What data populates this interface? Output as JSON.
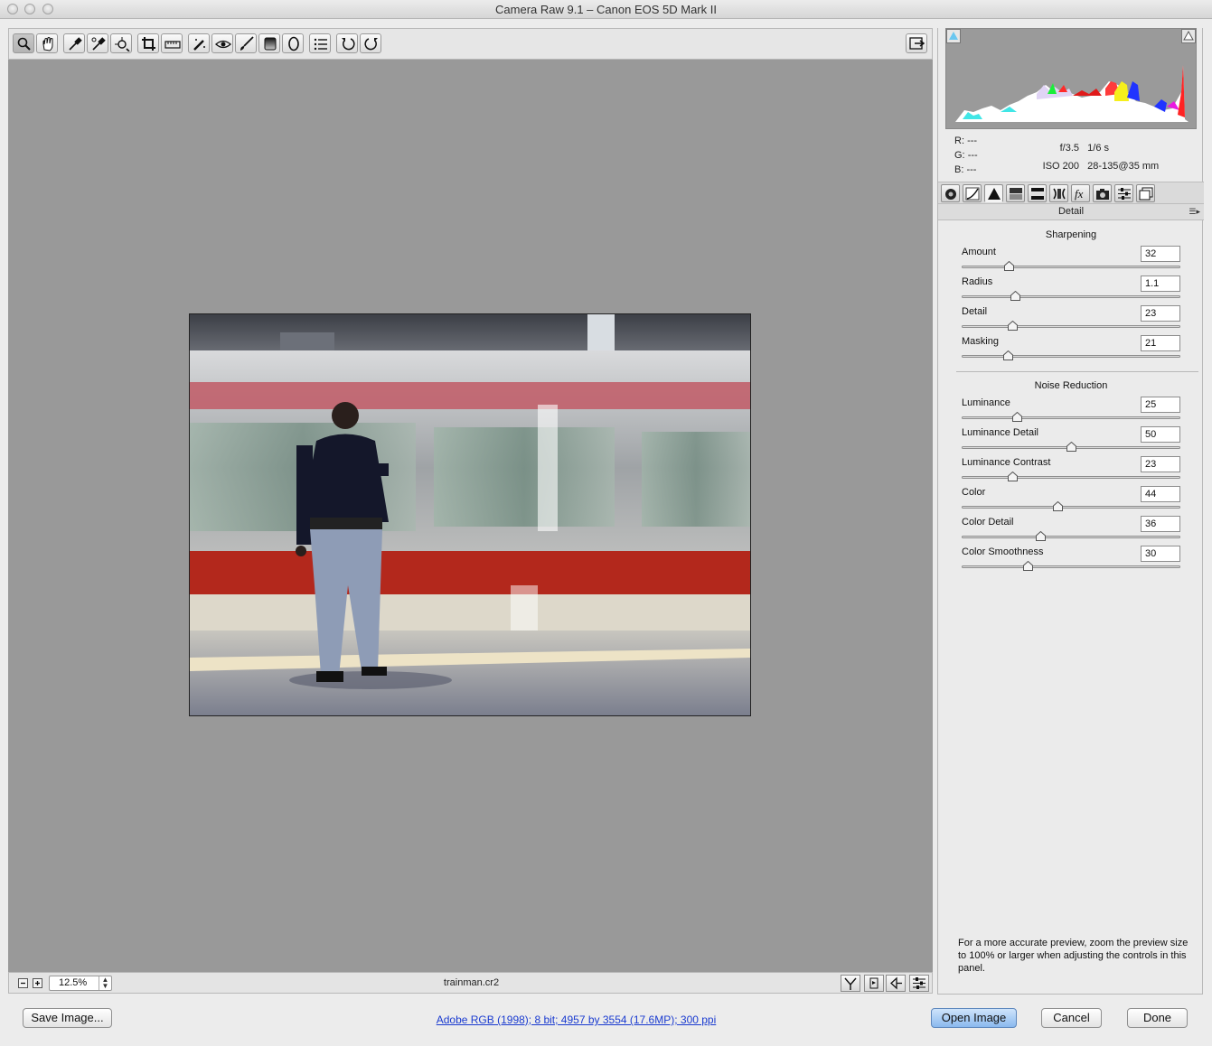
{
  "window": {
    "title": "Camera Raw 9.1  –  Canon EOS 5D Mark II"
  },
  "toolbar": {
    "tools": [
      {
        "name": "zoom-tool",
        "icon": "magnifier-icon"
      },
      {
        "name": "hand-tool",
        "icon": "hand-icon"
      },
      {
        "name": "white-balance-tool",
        "icon": "eyedropper-icon"
      },
      {
        "name": "color-sampler-tool",
        "icon": "color-sampler-icon"
      },
      {
        "name": "targeted-adjustment-tool",
        "icon": "target-adjust-icon"
      },
      {
        "name": "crop-tool",
        "icon": "crop-icon"
      },
      {
        "name": "straighten-tool",
        "icon": "straighten-icon"
      },
      {
        "name": "spot-removal-tool",
        "icon": "spot-removal-icon"
      },
      {
        "name": "red-eye-tool",
        "icon": "red-eye-icon"
      },
      {
        "name": "adjustment-brush-tool",
        "icon": "brush-icon"
      },
      {
        "name": "graduated-filter-tool",
        "icon": "graduated-filter-icon"
      },
      {
        "name": "radial-filter-tool",
        "icon": "radial-filter-icon"
      },
      {
        "name": "preferences-tool",
        "icon": "list-icon"
      },
      {
        "name": "rotate-left-tool",
        "icon": "rotate-ccw-icon"
      },
      {
        "name": "rotate-right-tool",
        "icon": "rotate-cw-icon"
      }
    ],
    "fullscreen_icon": "fullscreen-icon"
  },
  "status": {
    "zoom": "12.5%",
    "filename": "trainman.cr2"
  },
  "readout": {
    "r_label": "R:",
    "r_value": "---",
    "g_label": "G:",
    "g_value": "---",
    "b_label": "B:",
    "b_value": "---",
    "aperture": "f/3.5",
    "shutter": "1/6 s",
    "iso": "ISO 200",
    "lens": "28-135@35 mm"
  },
  "panel": {
    "title": "Detail",
    "sharpening": {
      "heading": "Sharpening",
      "sliders": [
        {
          "label": "Amount",
          "value": "32",
          "pos": 0.213
        },
        {
          "label": "Radius",
          "value": "1.1",
          "pos": 0.243
        },
        {
          "label": "Detail",
          "value": "23",
          "pos": 0.23
        },
        {
          "label": "Masking",
          "value": "21",
          "pos": 0.21
        }
      ]
    },
    "noise": {
      "heading": "Noise Reduction",
      "sliders": [
        {
          "label": "Luminance",
          "value": "25",
          "pos": 0.25
        },
        {
          "label": "Luminance Detail",
          "value": "50",
          "pos": 0.5
        },
        {
          "label": "Luminance Contrast",
          "value": "23",
          "pos": 0.23
        },
        {
          "label": "Color",
          "value": "44",
          "pos": 0.44
        },
        {
          "label": "Color Detail",
          "value": "36",
          "pos": 0.36
        },
        {
          "label": "Color Smoothness",
          "value": "30",
          "pos": 0.3
        }
      ]
    },
    "note": "For a more accurate preview, zoom the preview size to 100% or larger when adjusting the controls in this panel."
  },
  "bottom": {
    "save_label": "Save Image...",
    "workflow_link": "Adobe RGB (1998); 8 bit; 4957 by 3554 (17.6MP); 300 ppi",
    "open_label": "Open Image",
    "cancel_label": "Cancel",
    "done_label": "Done"
  }
}
